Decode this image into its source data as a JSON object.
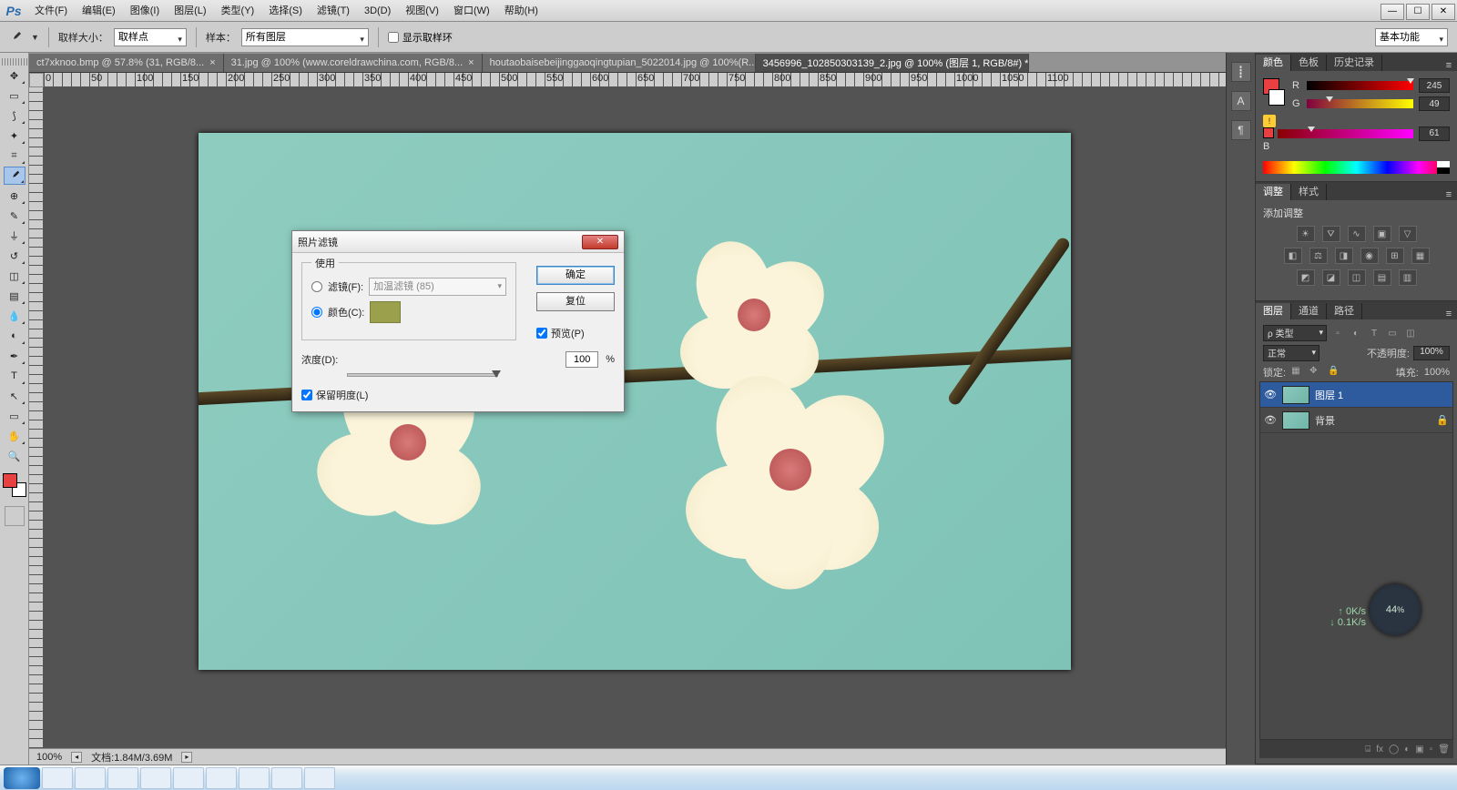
{
  "menubar": {
    "logo": "Ps",
    "items": [
      "文件(F)",
      "编辑(E)",
      "图像(I)",
      "图层(L)",
      "类型(Y)",
      "选择(S)",
      "滤镜(T)",
      "3D(D)",
      "视图(V)",
      "窗口(W)",
      "帮助(H)"
    ]
  },
  "options": {
    "sample_size_label": "取样大小：",
    "sample_size_value": "取样点",
    "sample_label": "样本：",
    "sample_value": "所有图层",
    "show_ring_label": "显示取样环",
    "workspace": "基本功能"
  },
  "tabs": [
    {
      "label": "ct7xknoo.bmp @ 57.8% (31, RGB/8...",
      "active": false
    },
    {
      "label": "31.jpg @ 100% (www.coreldrawchina.com, RGB/8...",
      "active": false
    },
    {
      "label": "houtaobaisebeijinggaoqingtupian_5022014.jpg @ 100%(R...",
      "active": false
    },
    {
      "label": "3456996_102850303139_2.jpg @ 100% (图层 1, RGB/8#) *",
      "active": true
    }
  ],
  "ruler_numbers": [
    "0",
    "50",
    "100",
    "150",
    "200",
    "250",
    "300",
    "350",
    "400",
    "450",
    "500",
    "550",
    "600",
    "650",
    "700",
    "750",
    "800",
    "850",
    "900",
    "950",
    "1000",
    "1050",
    "1100"
  ],
  "dialog": {
    "title": "照片滤镜",
    "fieldset_legend": "使用",
    "filter_radio": "滤镜(F):",
    "filter_value": "加温滤镜 (85)",
    "color_radio": "颜色(C):",
    "color_value": "#9ba04d",
    "density_label": "浓度(D):",
    "density_value": "100",
    "density_unit": "%",
    "preserve_label": "保留明度(L)",
    "ok": "确定",
    "reset": "复位",
    "preview": "预览(P)"
  },
  "color_panel": {
    "tabs": [
      "颜色",
      "色板",
      "历史记录"
    ],
    "r": "245",
    "g": "49",
    "b": "61"
  },
  "adjust_panel": {
    "tabs": [
      "调整",
      "样式"
    ],
    "heading": "添加调整"
  },
  "layers_panel": {
    "tabs": [
      "图层",
      "通道",
      "路径"
    ],
    "kind": "ρ 类型",
    "blend": "正常",
    "opacity_label": "不透明度:",
    "opacity": "100%",
    "lock_label": "锁定:",
    "fill_label": "填充:",
    "fill": "100%",
    "layers": [
      {
        "name": "图层 1",
        "active": true,
        "locked": false
      },
      {
        "name": "背景",
        "active": false,
        "locked": true
      }
    ]
  },
  "status": {
    "zoom": "100%",
    "doc": "文档:1.84M/3.69M"
  },
  "gauge": {
    "value": "44",
    "pct": "%",
    "up": "0K/s",
    "dn": "0.1K/s"
  }
}
